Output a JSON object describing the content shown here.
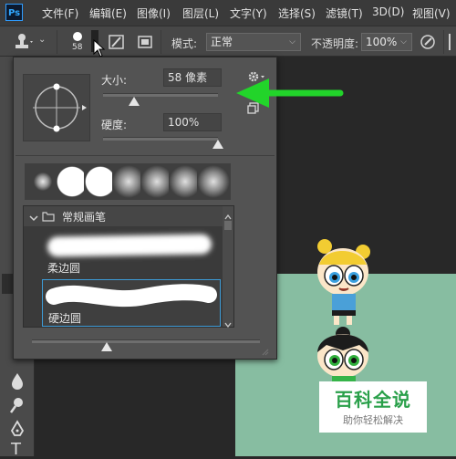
{
  "app": {
    "logo_text": "Ps"
  },
  "menu": {
    "items": [
      "文件(F)",
      "编辑(E)",
      "图像(I)",
      "图层(L)",
      "文字(Y)",
      "选择(S)",
      "滤镜(T)",
      "3D(D)",
      "视图(V)"
    ]
  },
  "options": {
    "brush_size_value": "58",
    "mode_label": "模式:",
    "mode_value": "正常",
    "opacity_label": "不透明度:",
    "opacity_value": "100%"
  },
  "brush_panel": {
    "size_label": "大小:",
    "size_value": "58 像素",
    "size_slider_fraction": 0.27,
    "hardness_label": "硬度:",
    "hardness_value": "100%",
    "hardness_slider_fraction": 1.0,
    "folder_label": "常规画笔",
    "brushes": [
      {
        "label": "柔边圆"
      },
      {
        "label": "硬边圆"
      }
    ]
  },
  "watermark": {
    "title": "百科全说",
    "subtitle": "助你轻松解决"
  },
  "colors": {
    "accent_green": "#22d42a",
    "selection_blue": "#3d9bd6",
    "canvas_green": "#87bda1"
  }
}
